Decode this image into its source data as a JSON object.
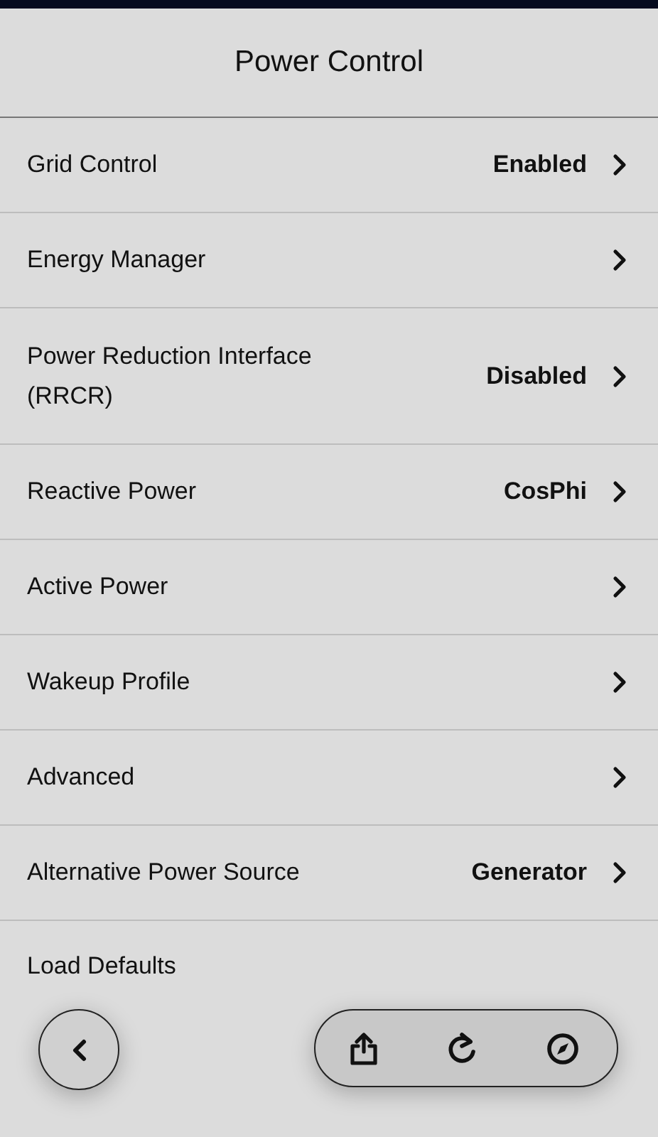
{
  "header": {
    "title": "Power Control"
  },
  "items": [
    {
      "kind": "link",
      "label": "Grid Control",
      "value": "Enabled"
    },
    {
      "kind": "link",
      "label": "Energy Manager"
    },
    {
      "kind": "link",
      "label": "Power Reduction Interface (RRCR)",
      "value": "Disabled"
    },
    {
      "kind": "link",
      "label": "Reactive Power",
      "value": "CosPhi"
    },
    {
      "kind": "link",
      "label": "Active Power"
    },
    {
      "kind": "link",
      "label": "Wakeup Profile"
    },
    {
      "kind": "link",
      "label": "Advanced"
    },
    {
      "kind": "link",
      "label": "Alternative Power Source",
      "value": "Generator"
    },
    {
      "kind": "action",
      "label": "Load Defaults"
    }
  ]
}
